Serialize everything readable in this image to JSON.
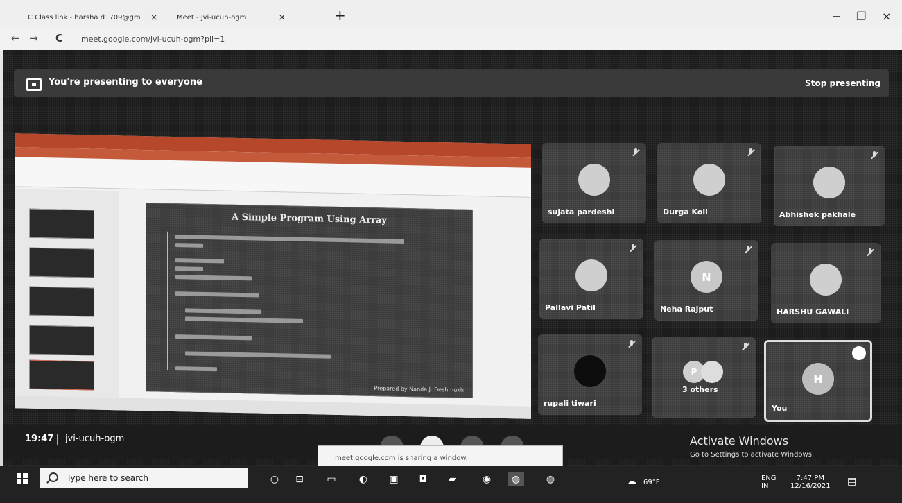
{
  "browser": {
    "tabs": [
      {
        "label": "C Class link - harsha d1709@gm",
        "close": "×"
      },
      {
        "label": "Meet - jvi-ucuh-ogm",
        "close": "×"
      }
    ],
    "new_tab": "+",
    "window_controls": {
      "minimize": "−",
      "restore": "❐",
      "close": "×"
    },
    "url": "meet.google.com/jvi-ucuh-ogm?pli=1",
    "nav": {
      "back": "←",
      "forward": "→",
      "reload": "C"
    }
  },
  "presenting": {
    "banner_text": "You're presenting to everyone",
    "stop_label": "Stop presenting"
  },
  "slide": {
    "title": "A Simple Program Using Array",
    "credit": "Prepared by Nanda J. Deshmukh"
  },
  "participants": [
    {
      "name": "sujata pardeshi",
      "initial": ""
    },
    {
      "name": "Durga Koli",
      "initial": ""
    },
    {
      "name": "Abhishek pakhale",
      "initial": ""
    },
    {
      "name": "Pallavi Patil",
      "initial": ""
    },
    {
      "name": "Neha Rajput",
      "initial": "N"
    },
    {
      "name": "HARSHU GAWALI",
      "initial": ""
    },
    {
      "name": "rupali tiwari",
      "initial": ""
    },
    {
      "name": "3 others",
      "initial": "P"
    },
    {
      "name": "You",
      "initial": "H"
    }
  ],
  "meeting": {
    "time": "19:47",
    "separator": "|",
    "code": "jvi-ucuh-ogm"
  },
  "toast": {
    "text": "meet.google.com is sharing a window."
  },
  "activate": {
    "title": "Activate Windows",
    "subtitle": "Go to Settings to activate Windows."
  },
  "taskbar": {
    "search_placeholder": "Type here to search",
    "weather": "69°F",
    "lang_line1": "ENG",
    "lang_line2": "IN",
    "clock_time": "7:47 PM",
    "clock_date": "12/16/2021"
  }
}
